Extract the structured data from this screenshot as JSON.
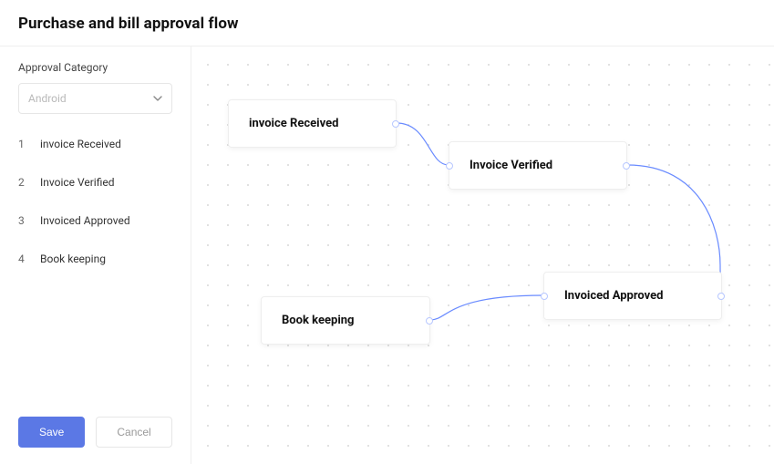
{
  "header": {
    "title": "Purchase and bill approval flow"
  },
  "sidebar": {
    "category_label": "Approval Category",
    "category_value": "Android",
    "steps": [
      {
        "num": "1",
        "label": "invoice Received"
      },
      {
        "num": "2",
        "label": "Invoice Verified"
      },
      {
        "num": "3",
        "label": "Invoiced Approved"
      },
      {
        "num": "4",
        "label": "Book keeping"
      }
    ],
    "save_label": "Save",
    "cancel_label": "Cancel"
  },
  "canvas": {
    "nodes": {
      "n1": "invoice Received",
      "n2": "Invoice Verified",
      "n3": "Invoiced Approved",
      "n4": "Book keeping"
    }
  },
  "colors": {
    "primary": "#5b78e5",
    "wire": "#6a8bff",
    "border": "#e6e6e6"
  }
}
